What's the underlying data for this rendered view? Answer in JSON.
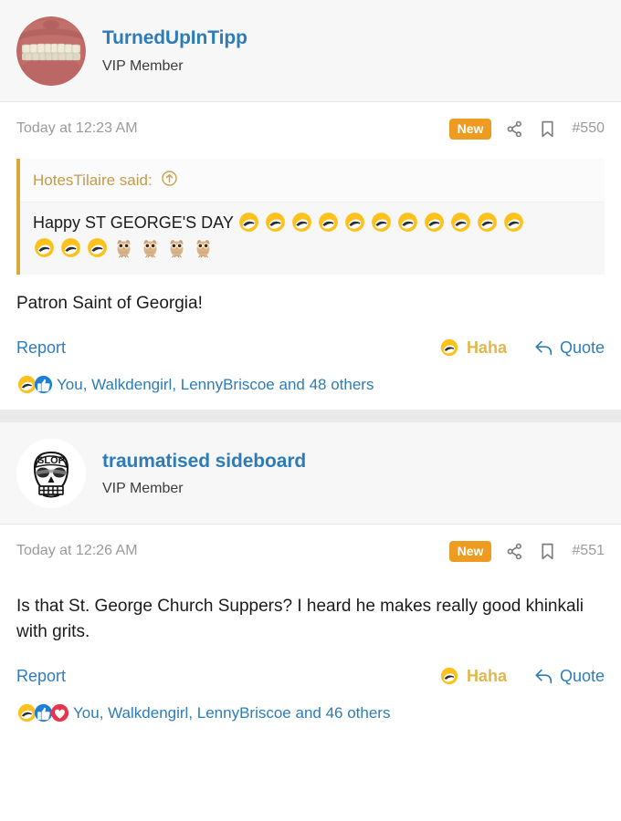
{
  "posts": [
    {
      "user": {
        "name": "TurnedUpInTipp",
        "title": "VIP Member",
        "avatar_icon": "teeth-photo-avatar"
      },
      "date": "Today at 12:23 AM",
      "badge": "New",
      "share_icon": "share-icon",
      "bookmark_icon": "bookmark-icon",
      "post_number": "#550",
      "quote": {
        "attribution": "HotesTilaire said:",
        "jump_icon": "arrow-up-circle-icon",
        "text": "Happy ST GEORGE'S DAY",
        "emoji_line1": [
          "rofl",
          "rofl",
          "rofl",
          "rofl",
          "rofl",
          "rofl",
          "rofl",
          "rofl",
          "rofl",
          "rofl",
          "rofl"
        ],
        "emoji_line2": [
          "rofl",
          "rofl",
          "rofl",
          "owl",
          "owl",
          "owl",
          "owl"
        ]
      },
      "body": "Patron Saint of Georgia!",
      "report_label": "Report",
      "reaction": {
        "icon": "rofl",
        "label": "Haha"
      },
      "quote_action": {
        "icon": "reply-arrow-icon",
        "label": "Quote"
      },
      "reactions_summary": {
        "icons": [
          "rofl",
          "thumbs-up",
          ""
        ],
        "text": "You, Walkdengirl, LennyBriscoe and 48 others"
      }
    },
    {
      "user": {
        "name": "traumatised sideboard",
        "title": "VIP Member",
        "avatar_icon": "skull-slop-avatar"
      },
      "date": "Today at 12:26 AM",
      "badge": "New",
      "share_icon": "share-icon",
      "bookmark_icon": "bookmark-icon",
      "post_number": "#551",
      "body": "Is that St. George Church Suppers? I heard he makes really good khinkali with grits.",
      "report_label": "Report",
      "reaction": {
        "icon": "rofl",
        "label": "Haha"
      },
      "quote_action": {
        "icon": "reply-arrow-icon",
        "label": "Quote"
      },
      "reactions_summary": {
        "icons": [
          "rofl",
          "thumbs-up",
          "heart"
        ],
        "text": "You, Walkdengirl, LennyBriscoe and 46 others"
      }
    }
  ],
  "colors": {
    "username_link": "#2d7cb8",
    "badge_new": "#ed9b21",
    "quote_border": "#d9a93a",
    "quote_attribution": "#c29a4a",
    "reaction_label": "#e0b84a",
    "muted_text": "#9a9a9a",
    "body_text": "#1b1b1b",
    "header_bg": "#f7f7f8"
  }
}
